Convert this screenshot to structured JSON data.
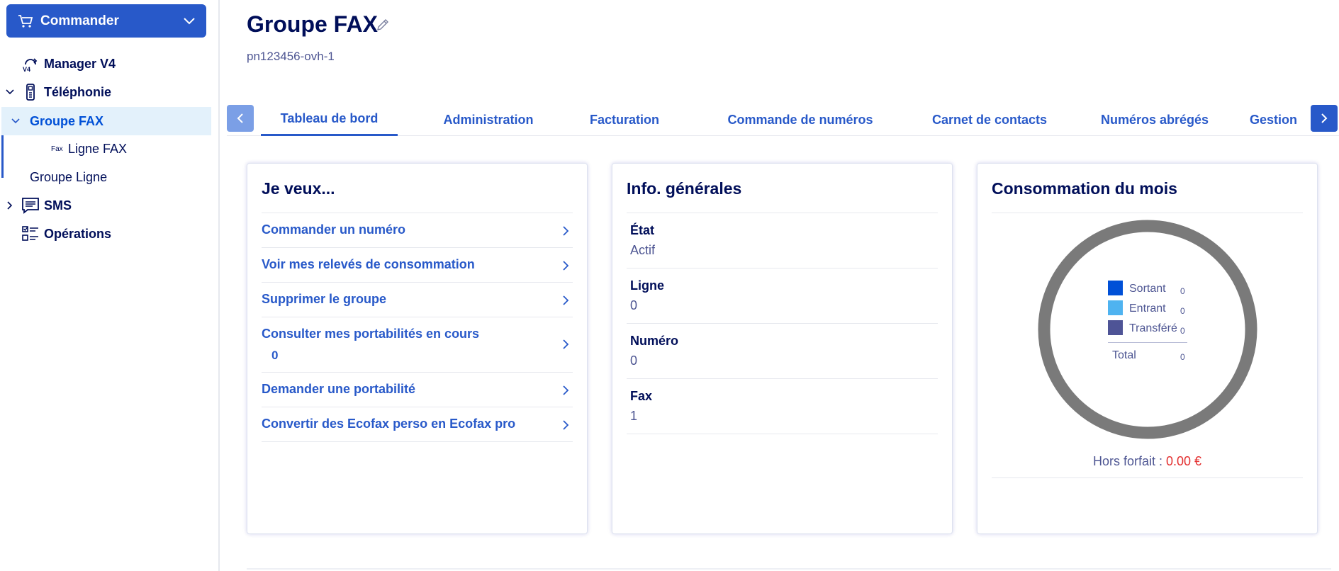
{
  "sidebar": {
    "order_button": "Commander",
    "items": [
      {
        "label": "Manager V4",
        "icon": "manager-v4-icon"
      },
      {
        "label": "Téléphonie",
        "icon": "phone-icon"
      },
      {
        "label": "Groupe FAX"
      },
      {
        "label": "Ligne FAX",
        "prefix": "Fax"
      },
      {
        "label": "Groupe Ligne"
      },
      {
        "label": "SMS",
        "icon": "sms-icon"
      },
      {
        "label": "Opérations",
        "icon": "operations-icon"
      }
    ]
  },
  "header": {
    "title": "Groupe FAX",
    "subtitle": "pn123456-ovh-1"
  },
  "tabs": [
    "Tableau de bord",
    "Administration",
    "Facturation",
    "Commande de numéros",
    "Carnet de contacts",
    "Numéros abrégés",
    "Gestion"
  ],
  "actions_card": {
    "title": "Je veux...",
    "items": [
      "Commander un numéro",
      "Voir mes relevés de consommation",
      "Supprimer le groupe",
      "Consulter mes portabilités en cours",
      "Demander une portabilité",
      "Convertir des Ecofax perso en Ecofax pro"
    ],
    "portability_count": "0"
  },
  "info_card": {
    "title": "Info. générales",
    "rows": [
      {
        "label": "État",
        "value": "Actif"
      },
      {
        "label": "Ligne",
        "value": "0"
      },
      {
        "label": "Numéro",
        "value": "0"
      },
      {
        "label": "Fax",
        "value": "1"
      }
    ]
  },
  "consumption_card": {
    "title": "Consommation du mois",
    "legend": [
      {
        "label": "Sortant",
        "value": "0",
        "color": "#0050d7"
      },
      {
        "label": "Entrant",
        "value": "0",
        "color": "#4fb3f0"
      },
      {
        "label": "Transféré",
        "value": "0",
        "color": "#4e5496"
      }
    ],
    "total_label": "Total",
    "total_value": "0",
    "out_of_plan_label": "Hors forfait :",
    "out_of_plan_value": "0.00 €"
  },
  "colors": {
    "primary": "#2859c9",
    "title": "#000e59",
    "ring": "#7a7a7a",
    "red": "#e32f2f"
  }
}
